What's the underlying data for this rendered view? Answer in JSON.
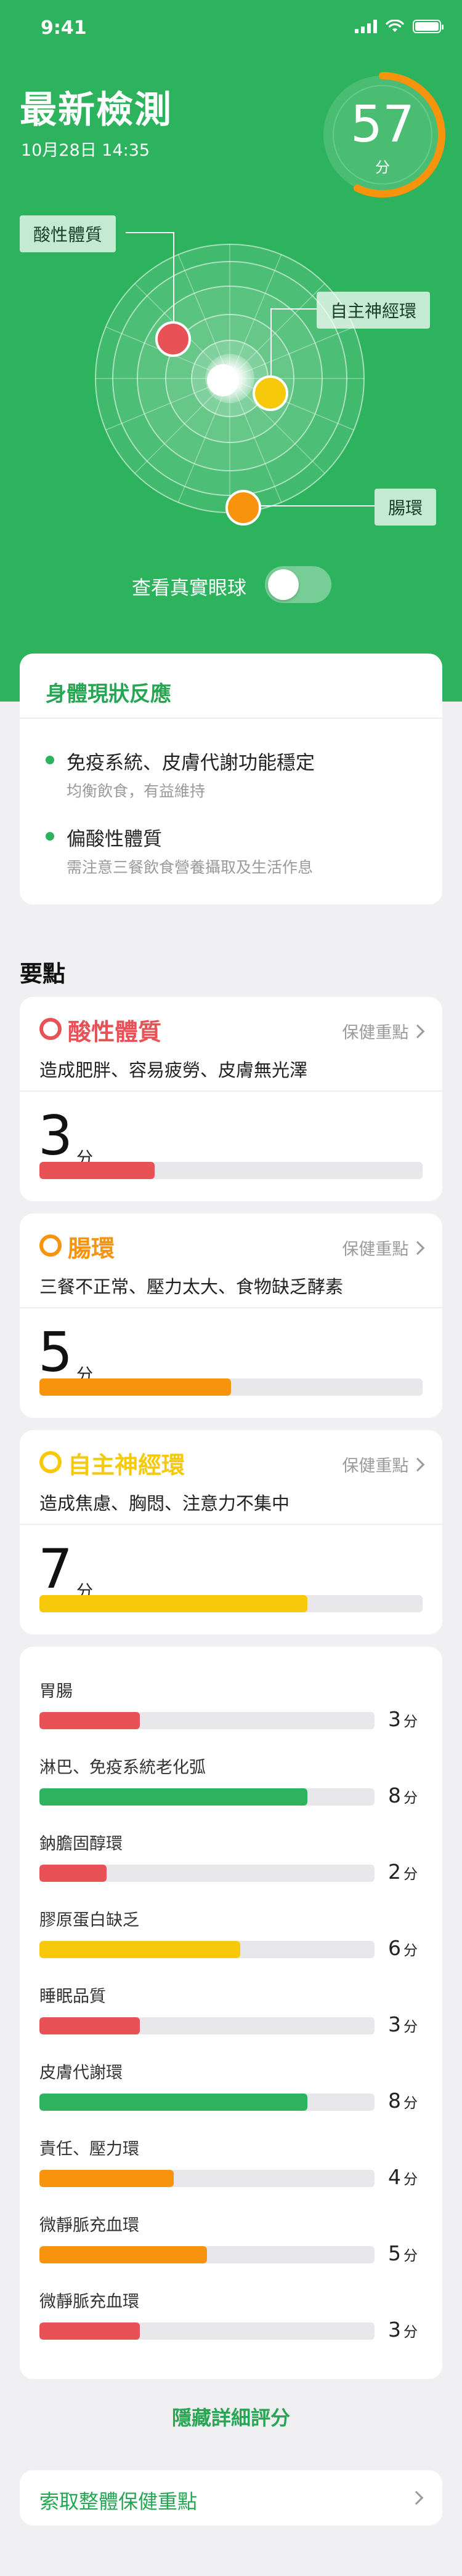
{
  "status": {
    "time": "9:41"
  },
  "hero": {
    "title": "最新檢測",
    "date": "10月28日 14:35",
    "score": "57",
    "score_unit": "分",
    "score_ratio": 0.57,
    "tags": {
      "acid": "酸性體質",
      "nerve": "自主神經環",
      "gut": "腸環"
    },
    "toggle_label": "查看真實眼球",
    "toggle_on": false
  },
  "reaction": {
    "title": "身體現狀反應",
    "items": [
      {
        "main": "免疫系統、皮膚代謝功能穩定",
        "sub": "均衡飲食，有益維持"
      },
      {
        "main": "偏酸性體質",
        "sub": "需注意三餐飲食營養攝取及生活作息"
      }
    ]
  },
  "key_points": {
    "title": "要點",
    "link_label": "保健重點",
    "unit": "分",
    "cards": [
      {
        "name": "酸性體質",
        "desc": "造成肥胖、容易疲勞、皮膚無光澤",
        "score": "3",
        "ratio": 0.3,
        "color": "#e85256"
      },
      {
        "name": "腸環",
        "desc": "三餐不正常、壓力太大、食物缺乏酵素",
        "score": "5",
        "ratio": 0.5,
        "color": "#f7930c"
      },
      {
        "name": "自主神經環",
        "desc": "造成焦慮、胸悶、注意力不集中",
        "score": "7",
        "ratio": 0.7,
        "color": "#f6c90b"
      }
    ]
  },
  "details": {
    "unit": "分",
    "items": [
      {
        "label": "胃腸",
        "score": "3",
        "ratio": 0.3,
        "color": "#e85256"
      },
      {
        "label": "淋巴、免疫系統老化弧",
        "score": "8",
        "ratio": 0.8,
        "color": "#2db35d"
      },
      {
        "label": "鈉膽固醇環",
        "score": "2",
        "ratio": 0.2,
        "color": "#e85256"
      },
      {
        "label": "膠原蛋白缺乏",
        "score": "6",
        "ratio": 0.6,
        "color": "#f6c90b"
      },
      {
        "label": "睡眠品質",
        "score": "3",
        "ratio": 0.3,
        "color": "#e85256"
      },
      {
        "label": "皮膚代謝環",
        "score": "8",
        "ratio": 0.8,
        "color": "#2db35d"
      },
      {
        "label": "責任、壓力環",
        "score": "4",
        "ratio": 0.4,
        "color": "#f7930c"
      },
      {
        "label": "微靜脈充血環",
        "score": "5",
        "ratio": 0.5,
        "color": "#f7930c"
      },
      {
        "label": "微靜脈充血環",
        "score": "3",
        "ratio": 0.3,
        "color": "#e85256"
      }
    ]
  },
  "hide_label": "隱藏詳細評分",
  "bottom_link": "索取整體保健重點",
  "colors": {
    "brand": "#2db35d",
    "red": "#e85256",
    "orange": "#f7930c",
    "yellow": "#f6c90b",
    "track": "#e8e8ea"
  }
}
